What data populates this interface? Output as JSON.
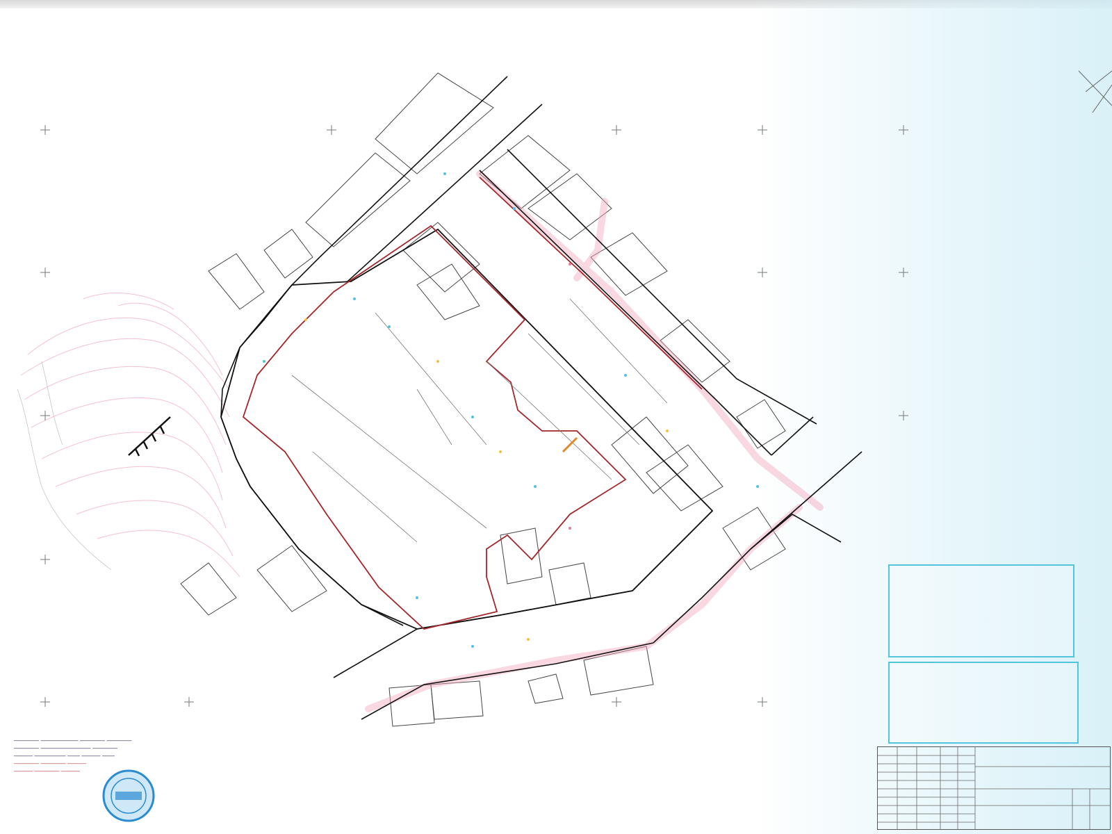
{
  "sheet": {
    "note_lines": [
      "———— —————— ———— ————",
      "———— ———————— ————",
      "——— ————— —— ——— ——",
      "———— ———— ———",
      "——— ———— ———"
    ],
    "stamp_alt": "round blue stamp",
    "approval_lines": [
      "",
      "",
      "",
      "",
      ""
    ],
    "titleblock_cells": [
      "",
      "",
      "",
      "",
      "",
      "",
      "",
      ""
    ]
  },
  "colors": {
    "boundary_red": "#a3262a",
    "road_black": "#111111",
    "pink_zone": "#f2a9bd",
    "blue_stamp": "#2a8bd2",
    "cyan_frame": "#53c4dd"
  },
  "icons": [
    "north-arrow-icon",
    "grid-cross-icon",
    "stamp-icon"
  ]
}
